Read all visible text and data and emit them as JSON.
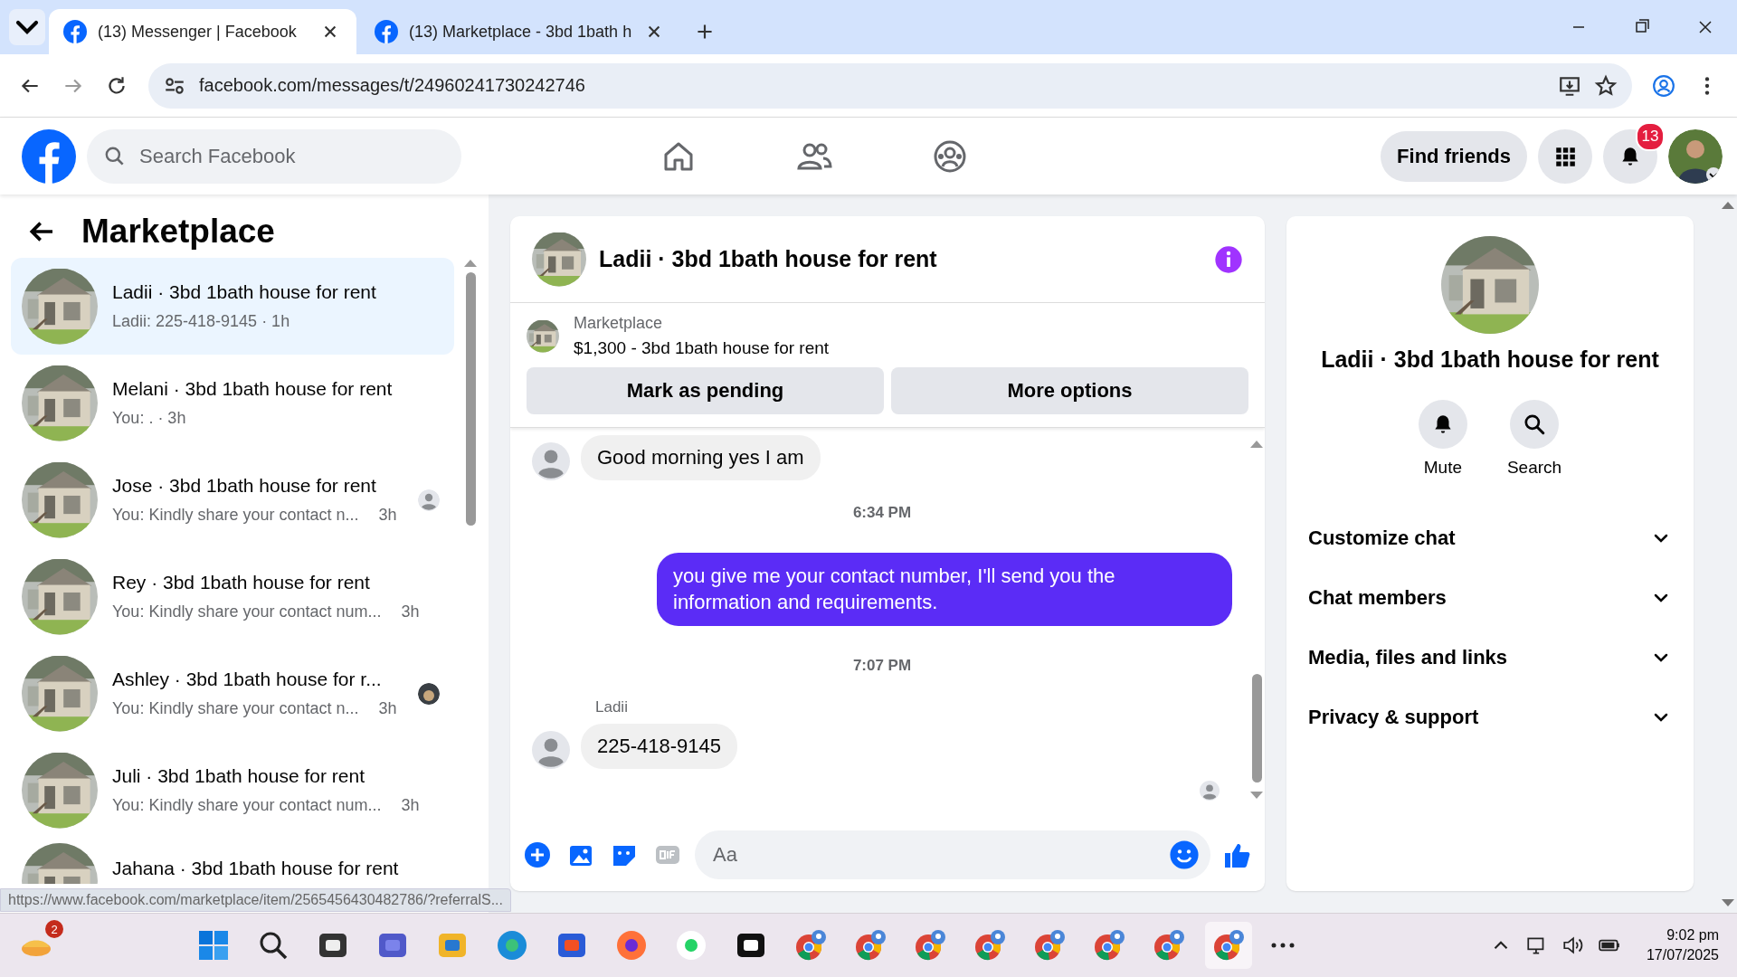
{
  "browser": {
    "tabs": [
      {
        "title": "(13) Messenger | Facebook",
        "selected": true
      },
      {
        "title": "(13) Marketplace - 3bd 1bath h",
        "selected": false
      }
    ],
    "url": "facebook.com/messages/t/24960241730242746"
  },
  "header": {
    "search": {
      "placeholder": "Search Facebook"
    },
    "find_friends": "Find friends",
    "notification_count": "13"
  },
  "sidebar": {
    "title": "Marketplace",
    "conversations": [
      {
        "title": "Ladii · 3bd 1bath house for rent",
        "preview": "Ladii: 225-418-9145 · 1h",
        "selected": true
      },
      {
        "title": "Melani · 3bd 1bath house for rent",
        "preview": "You: . · 3h",
        "selected": false
      },
      {
        "title": "Jose · 3bd 1bath house for rent",
        "preview": "You: Kindly share your contact n...",
        "time": "3h",
        "selected": false,
        "receipt": {
          "kind": "person"
        }
      },
      {
        "title": "Rey · 3bd 1bath house for rent",
        "preview": "You: Kindly share your contact num...",
        "time": "3h",
        "selected": false
      },
      {
        "title": "Ashley · 3bd 1bath house for r...",
        "preview": "You: Kindly share your contact n...",
        "time": "3h",
        "selected": false
      },
      {
        "title": "Juli · 3bd 1bath house for rent",
        "preview": "You: Kindly share your contact num...",
        "time": "3h",
        "selected": false
      },
      {
        "title": "Jahana · 3bd 1bath house for rent",
        "selected": false
      }
    ]
  },
  "chat": {
    "title": "Ladii · 3bd 1bath house for rent",
    "listing": {
      "label": "Marketplace",
      "title": "$1,300 - 3bd 1bath house for rent"
    },
    "buttons": [
      "Mark as pending",
      "More options"
    ],
    "messages": [
      {
        "kind": "incoming",
        "text": "Good morning yes I am"
      },
      {
        "kind": "timestamp",
        "text": "6:34 PM"
      },
      {
        "kind": "outgoing",
        "text": "you give me your contact number, I'll send you the information and requirements."
      },
      {
        "kind": "timestamp",
        "text": "7:07 PM"
      },
      {
        "kind": "incoming",
        "sender": "Ladii",
        "text": "225-418-9145"
      }
    ],
    "composer": {
      "placeholder": "Aa"
    }
  },
  "details": {
    "title": "Ladii · 3bd 1bath house for rent",
    "actions": [
      {
        "kind": "bell",
        "label": "Mute"
      },
      {
        "kind": "search",
        "label": "Search"
      }
    ],
    "sections": [
      "Customize chat",
      "Chat members",
      "Media, files and links",
      "Privacy & support"
    ]
  },
  "status_url": "https://www.facebook.com/marketplace/item/2565456430482786/?referralS...",
  "taskbar": {
    "badge": "2",
    "time": "9:02 pm",
    "date": "17/07/2025"
  }
}
